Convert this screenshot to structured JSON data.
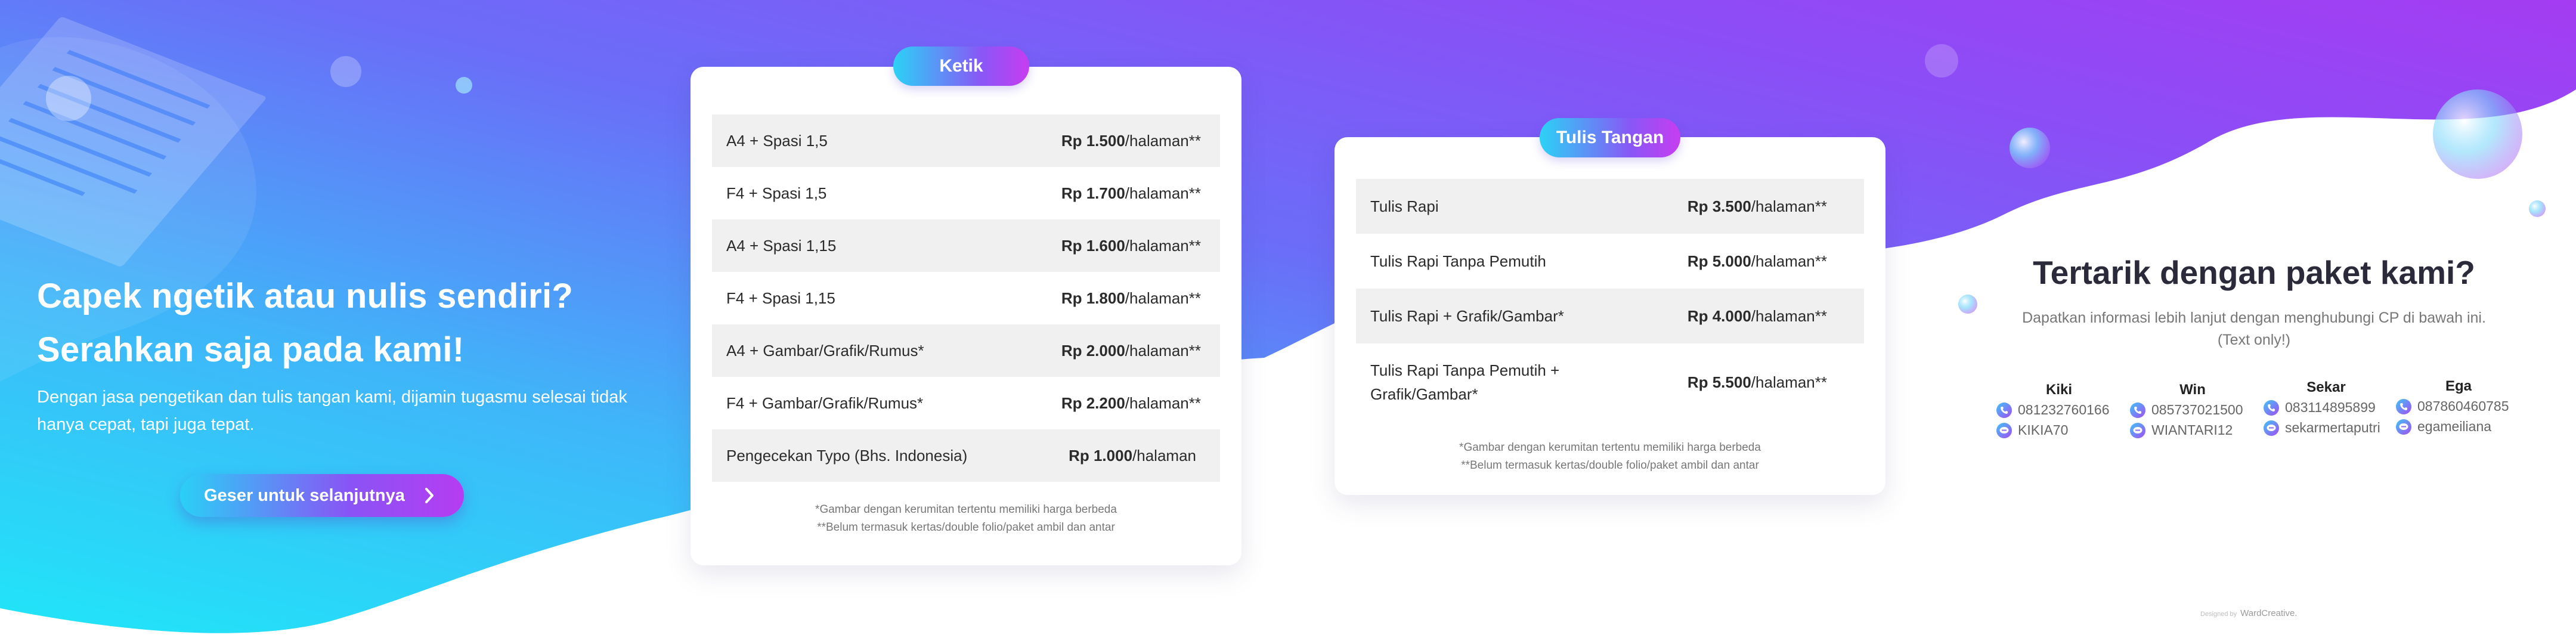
{
  "hero": {
    "title_line1": "Capek ngetik atau nulis sendiri?",
    "title_line2": "Serahkan saja pada kami!",
    "description": "Dengan jasa pengetikan dan tulis tangan kami, dijamin tugasmu selesai tidak hanya cepat, tapi juga tepat.",
    "button_label": "Geser untuk selanjutnya"
  },
  "ketik": {
    "label": "Ketik",
    "rows": [
      {
        "item": "A4 + Spasi 1,5",
        "price": "Rp 1.500",
        "unit": "/halaman**"
      },
      {
        "item": "F4 + Spasi 1,5",
        "price": "Rp 1.700",
        "unit": "/halaman**"
      },
      {
        "item": "A4 + Spasi 1,15",
        "price": "Rp 1.600",
        "unit": "/halaman**"
      },
      {
        "item": "F4 + Spasi 1,15",
        "price": "Rp 1.800",
        "unit": "/halaman**"
      },
      {
        "item": "A4 + Gambar/Grafik/Rumus*",
        "price": "Rp 2.000",
        "unit": "/halaman**"
      },
      {
        "item": "F4 + Gambar/Grafik/Rumus*",
        "price": "Rp 2.200",
        "unit": "/halaman**"
      },
      {
        "item": "Pengecekan Typo (Bhs. Indonesia)",
        "price": "Rp 1.000",
        "unit": "/halaman"
      }
    ],
    "note1": "*Gambar dengan kerumitan tertentu memiliki harga berbeda",
    "note2": "**Belum termasuk kertas/double folio/paket ambil dan antar"
  },
  "tulis": {
    "label": "Tulis Tangan",
    "rows": [
      {
        "item": "Tulis Rapi",
        "price": "Rp 3.500",
        "unit": "/halaman**"
      },
      {
        "item": "Tulis Rapi Tanpa Pemutih",
        "price": "Rp 5.000",
        "unit": "/halaman**"
      },
      {
        "item": "Tulis Rapi + Grafik/Gambar*",
        "price": "Rp 4.000",
        "unit": "/halaman**"
      },
      {
        "item": "Tulis Rapi Tanpa Pemutih + Grafik/Gambar*",
        "price": "Rp 5.500",
        "unit": "/halaman**"
      }
    ],
    "note1": "*Gambar dengan kerumitan tertentu memiliki harga berbeda",
    "note2": "**Belum termasuk kertas/double folio/paket ambil dan antar"
  },
  "contact": {
    "title": "Tertarik dengan paket kami?",
    "subtitle": "Dapatkan informasi lebih lanjut dengan menghubungi CP di bawah ini. (Text only!)",
    "people": [
      {
        "name": "Kiki",
        "phone": "081232760166",
        "line": "KIKIA70"
      },
      {
        "name": "Win",
        "phone": "085737021500",
        "line": "WIANTARI12"
      },
      {
        "name": "Sekar",
        "phone": "083114895899",
        "line": "sekarmertaputri"
      },
      {
        "name": "Ega",
        "phone": "087860460785",
        "line": "egameiliana"
      }
    ]
  },
  "credit": {
    "small": "Designed by",
    "name": "WardCreative."
  },
  "icons": {
    "phone": "phone-icon",
    "line": "line-chat-icon",
    "chevron": "chevron-right-icon"
  },
  "colors": {
    "cyan": "#22d3f8",
    "purple": "#9b45f4",
    "blue": "#5f7cf8",
    "text_dark": "#2a2a3a"
  }
}
